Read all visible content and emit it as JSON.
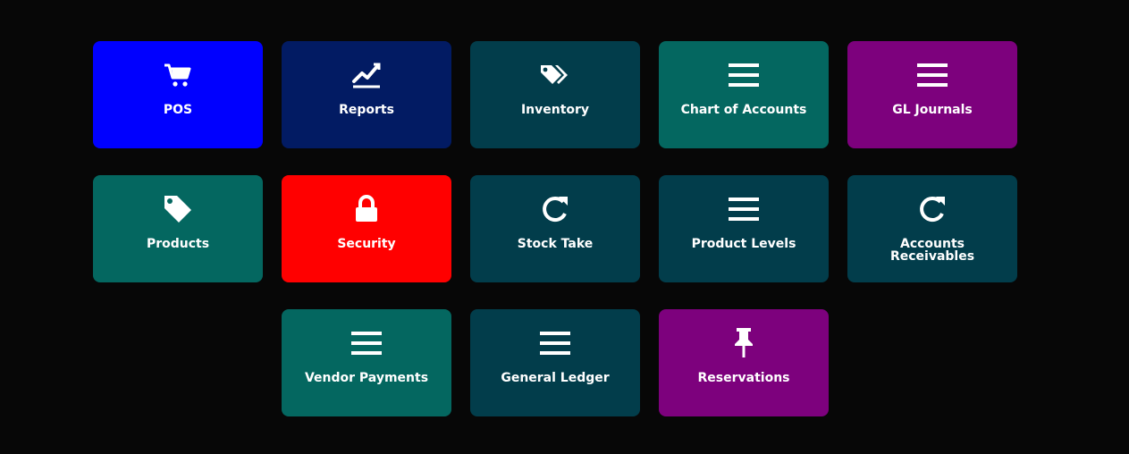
{
  "colors": {
    "background": "#070707",
    "blue": "#0000ff",
    "navy": "#021b63",
    "dark_teal": "#023d4b",
    "teal": "#046760",
    "purple": "#7d017d",
    "red": "#ff0000",
    "icon": "#ffffff"
  },
  "tiles": {
    "pos": {
      "label": "POS",
      "icon": "cart-icon",
      "color": "#0000ff"
    },
    "reports": {
      "label": "Reports",
      "icon": "line-chart-icon",
      "color": "#021b63"
    },
    "inventory": {
      "label": "Inventory",
      "icon": "tags-icon",
      "color": "#023d4b"
    },
    "chart_of_accounts": {
      "label": "Chart of Accounts",
      "icon": "bars-icon",
      "color": "#046760"
    },
    "gl_journals": {
      "label": "GL Journals",
      "icon": "bars-icon",
      "color": "#7d017d"
    },
    "products": {
      "label": "Products",
      "icon": "tag-icon",
      "color": "#046760"
    },
    "security": {
      "label": "Security",
      "icon": "lock-icon",
      "color": "#ff0000"
    },
    "stock_take": {
      "label": "Stock Take",
      "icon": "refresh-icon",
      "color": "#023d4b"
    },
    "product_levels": {
      "label": "Product Levels",
      "icon": "bars-icon",
      "color": "#023d4b"
    },
    "accounts_receivables": {
      "label": "Accounts\nReceivables",
      "icon": "refresh-icon",
      "color": "#023d4b"
    },
    "vendor_payments": {
      "label": "Vendor Payments",
      "icon": "bars-icon",
      "color": "#046760"
    },
    "general_ledger": {
      "label": "General Ledger",
      "icon": "bars-icon",
      "color": "#023d4b"
    },
    "reservations": {
      "label": "Reservations",
      "icon": "pushpin-icon",
      "color": "#7d017d"
    }
  }
}
